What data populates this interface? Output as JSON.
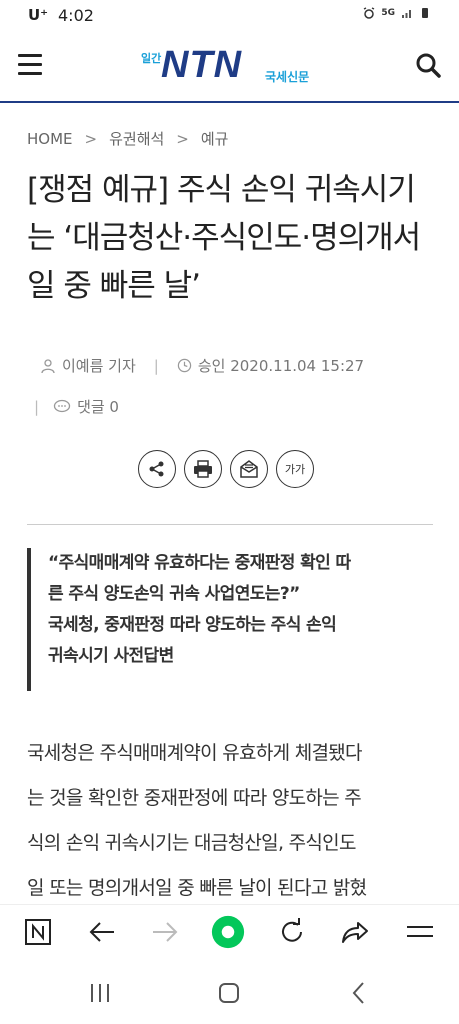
{
  "status": {
    "carrier": "U⁺",
    "time": "4:02",
    "network": "5G"
  },
  "header": {
    "logo_small": "일간",
    "logo_main": "NTN",
    "logo_sub": "국세신문"
  },
  "breadcrumb": {
    "home": "HOME",
    "sep": ">",
    "level1": "유권해석",
    "level2": "예규"
  },
  "article": {
    "title": "[쟁점 예규] 주식 손익 귀속시기는 ‘대금청산·주식인도·명의개서일 중 빠른 날’",
    "author": "이예름 기자",
    "approved": "승인 2020.11.04 15:27",
    "comments": "댓글 0",
    "font_size_label": "가가",
    "summary_lines": [
      "“주식매매계약 유효하다는 중재판정 확인 따",
      "른 주식 양도손익 귀속 사업연도는?”",
      "국세청, 중재판정 따라 양도하는 주식 손익",
      "귀속시기 사전답변"
    ],
    "body_lines": [
      "국세청은 주식매매계약이 유효하게 체결됐다",
      "는 것을 확인한 중재판정에 따라 양도하는 주",
      "식의 손익 귀속시기는 대금청산일, 주식인도",
      "일 또는 명의개서일 중 빠른 날이 된다고 밝혔"
    ]
  },
  "colors": {
    "brand_navy": "#1f3c86",
    "brand_cyan": "#1aa0d8",
    "naver_green": "#03c75a"
  }
}
